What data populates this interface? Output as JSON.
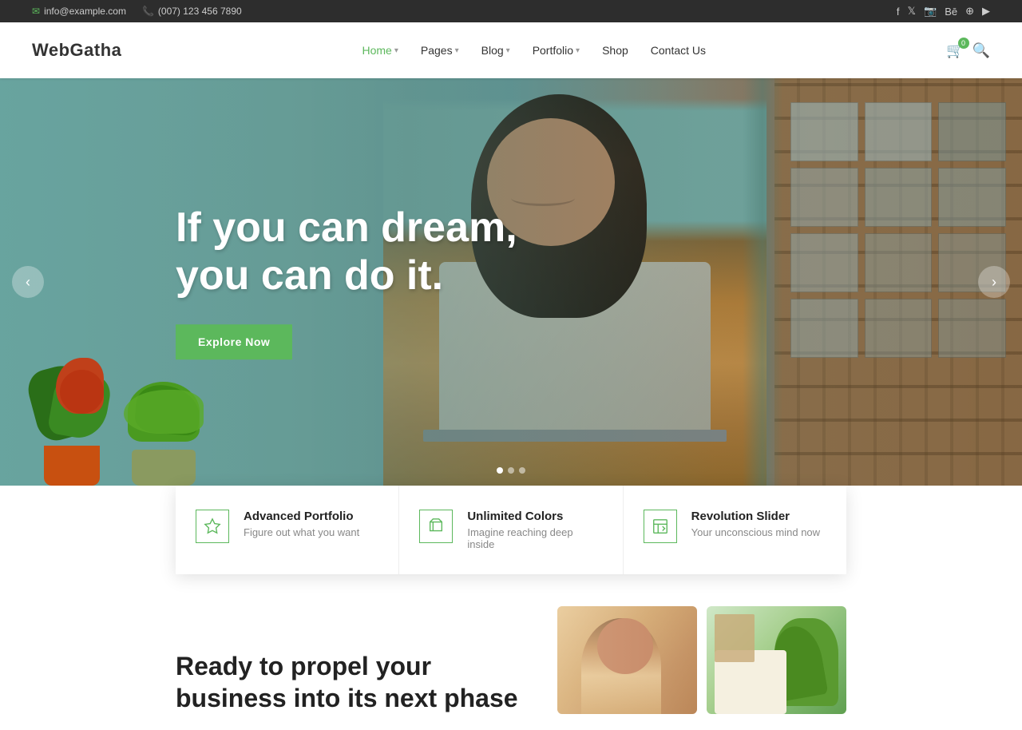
{
  "topbar": {
    "email": "info@example.com",
    "phone": "(007) 123 456 7890"
  },
  "header": {
    "logo": "WebGatha",
    "nav": [
      {
        "label": "Home",
        "hasDropdown": true,
        "active": true
      },
      {
        "label": "Pages",
        "hasDropdown": true
      },
      {
        "label": "Blog",
        "hasDropdown": true
      },
      {
        "label": "Portfolio",
        "hasDropdown": true
      },
      {
        "label": "Shop"
      },
      {
        "label": "Contact Us"
      }
    ],
    "cart_badge": "0"
  },
  "hero": {
    "title_line1": "If you can dream,",
    "title_line2": "you can do it.",
    "cta_label": "Explore Now"
  },
  "features": [
    {
      "icon": "star",
      "title": "Advanced Portfolio",
      "desc": "Figure out what you want"
    },
    {
      "icon": "flag",
      "title": "Unlimited Colors",
      "desc": "Imagine reaching deep inside"
    },
    {
      "icon": "image",
      "title": "Revolution Slider",
      "desc": "Your unconscious mind now"
    }
  ],
  "bottom": {
    "heading_line1": "Ready to propel your",
    "heading_line2": "business into its next phase"
  }
}
